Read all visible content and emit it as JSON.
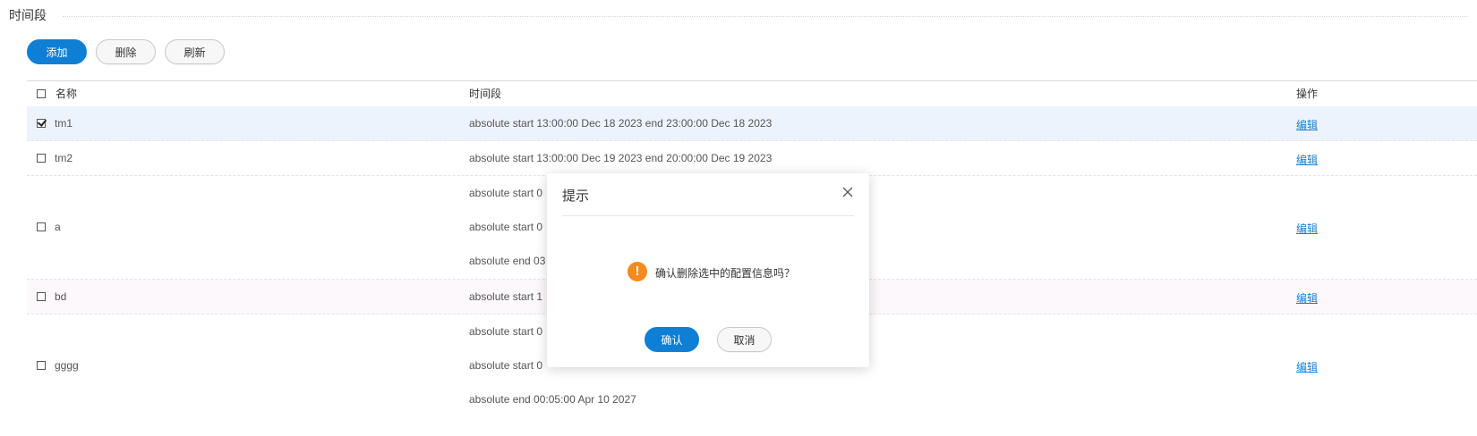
{
  "section": {
    "title": "时间段"
  },
  "toolbar": {
    "add_label": "添加",
    "delete_label": "删除",
    "refresh_label": "刷新"
  },
  "table": {
    "headers": {
      "name": "名称",
      "period": "时间段",
      "action": "操作"
    },
    "rows": [
      {
        "name": "tm1",
        "checked": true,
        "periods": [
          "absolute start 13:00:00 Dec 18 2023 end 23:00:00 Dec 18 2023"
        ],
        "action": "编辑"
      },
      {
        "name": "tm2",
        "checked": false,
        "periods": [
          "absolute start 13:00:00 Dec 19 2023 end 20:00:00 Dec 19 2023"
        ],
        "action": "编辑"
      },
      {
        "name": "a",
        "checked": false,
        "periods": [
          "absolute start 0",
          "absolute start 0",
          "absolute end 03"
        ],
        "action": "编辑"
      },
      {
        "name": "bd",
        "checked": false,
        "periods": [
          "absolute start 1"
        ],
        "action": "编辑"
      },
      {
        "name": "gggg",
        "checked": false,
        "periods": [
          "absolute start 0",
          "absolute start 0",
          "absolute end 00:05:00 Apr 10 2027"
        ],
        "action": "编辑"
      }
    ]
  },
  "modal": {
    "title": "提示",
    "message": "确认删除选中的配置信息吗？",
    "confirm_label": "确认",
    "cancel_label": "取消",
    "icon": "warning-icon"
  },
  "colors": {
    "primary": "#0f7fd6",
    "link": "#1a7fd0",
    "warning": "#f58a1f",
    "selected_row": "#edf3fd",
    "hover_row": "#fcf8fc"
  }
}
